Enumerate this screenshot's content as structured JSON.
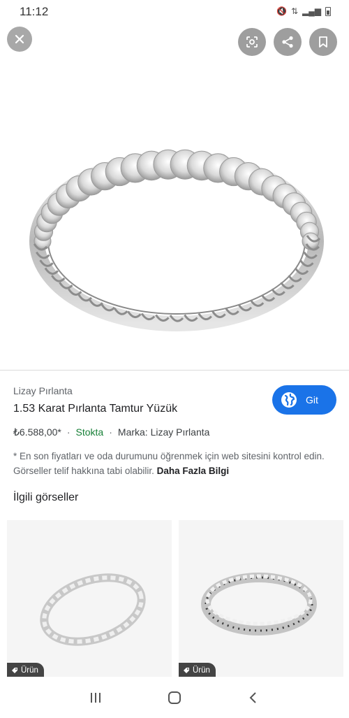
{
  "status_bar": {
    "time": "11:12"
  },
  "product": {
    "source": "Lizay Pırlanta",
    "title": "1.53 Karat Pırlanta Tamtur Yüzük",
    "price": "₺6.588,00*",
    "stock": "Stokta",
    "brand": "Marka: Lizay Pırlanta",
    "go_label": "Git"
  },
  "disclaimer": {
    "text": "* En son fiyatları ve oda durumunu öğrenmek için web sitesini kontrol edin. Görseller telif hakkına tabi olabilir.",
    "more_link": "Daha Fazla Bilgi"
  },
  "related": {
    "heading": "İlgili görseller",
    "items": [
      {
        "badge": "Ürün"
      },
      {
        "badge": "Ürün"
      }
    ]
  },
  "colors": {
    "accent": "#1a73e8",
    "in_stock": "#188038"
  },
  "icons": [
    "close-icon",
    "lens-icon",
    "share-icon",
    "bookmark-icon",
    "globe-icon",
    "tag-icon"
  ]
}
